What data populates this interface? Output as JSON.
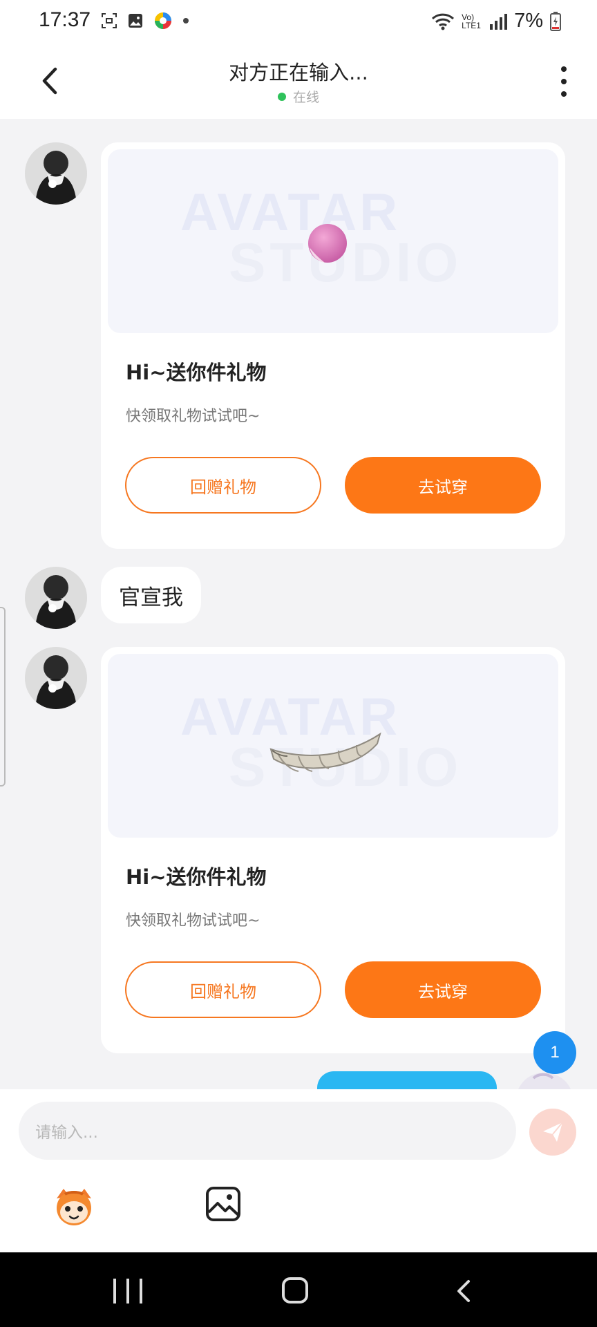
{
  "status_bar": {
    "time": "17:37",
    "battery": "7%",
    "network_label": "Vo) LTE1",
    "icons": [
      "screenshot-icon",
      "gallery-icon",
      "app-color-icon",
      "dot-icon",
      "wifi-icon",
      "signal-icon",
      "battery-icon"
    ]
  },
  "header": {
    "title": "对方正在输入...",
    "status": "在线",
    "status_color": "#2fc25b"
  },
  "messages": [
    {
      "type": "gift_card",
      "title": "Hi~送你件礼物",
      "description": "快领取礼物试试吧~",
      "watermark_line1": "AVATAR",
      "watermark_line2": "STUDIO",
      "gift_item": "pink-ball",
      "return_gift_label": "回赠礼物",
      "try_on_label": "去试穿"
    },
    {
      "type": "text",
      "text": "官宣我"
    },
    {
      "type": "gift_card",
      "title": "Hi~送你件礼物",
      "description": "快领取礼物试试吧~",
      "watermark_line1": "AVATAR",
      "watermark_line2": "STUDIO",
      "gift_item": "teeth-grill",
      "return_gift_label": "回赠礼物",
      "try_on_label": "去试穿"
    }
  ],
  "unread_badge": "1",
  "composer": {
    "placeholder": "请输入...",
    "send_color": "#fbd7cf"
  },
  "accent_colors": {
    "orange": "#fd7716",
    "blue": "#2ab7f2",
    "badge": "#1e90f0"
  }
}
